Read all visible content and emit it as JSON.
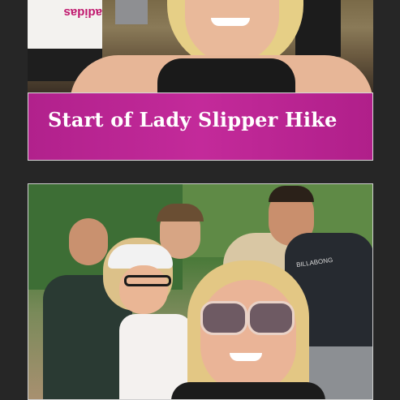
{
  "caption": {
    "title": "Start of Lady Slipper Hike"
  },
  "top_photo": {
    "shirt_text": "adidas"
  },
  "bottom_photo": {
    "shirt_text": "BILLABONG"
  },
  "colors": {
    "caption_bg": "#b1218c",
    "page_bg": "#262626"
  }
}
